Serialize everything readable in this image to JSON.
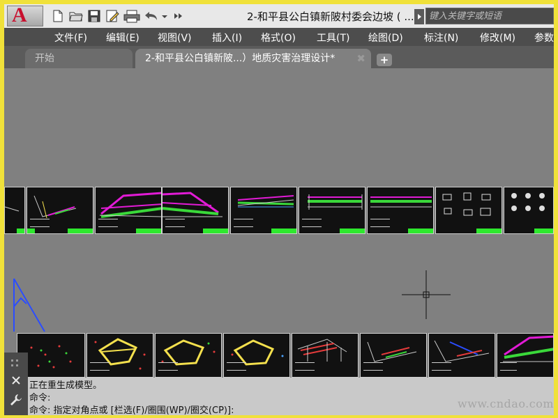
{
  "app": {
    "logo_letter": "A",
    "title": "2-和平县公白镇新陂村委会边坡 ( ..."
  },
  "search": {
    "placeholder": "键入关键字或短语"
  },
  "menu": [
    "文件(F)",
    "编辑(E)",
    "视图(V)",
    "插入(I)",
    "格式(O)",
    "工具(T)",
    "绘图(D)",
    "标注(N)",
    "修改(M)",
    "参数"
  ],
  "tabs": [
    {
      "label": "开始",
      "active": false
    },
    {
      "label": "2-和平县公白镇新陂...）地质灾害治理设计*",
      "active": true,
      "close_glyph": "✖"
    }
  ],
  "tab_add_glyph": "+",
  "command": {
    "lines": [
      "正在重生成模型。",
      "命令:",
      "命令: 指定对角点或 [栏选(F)/圈围(WP)/圈交(CP)]:"
    ]
  },
  "watermark": "www.cndao.com",
  "colors": {
    "accent_yellow": "#f0e13a",
    "sheet_stamp_green": "#2ee82e",
    "magenta": "#e21bd6",
    "logo_red": "#c8102e"
  },
  "icons": [
    "new-file-icon",
    "open-folder-icon",
    "save-icon",
    "save-as-icon",
    "print-icon",
    "undo-icon",
    "dropdown-icon",
    "more-icon",
    "wrench-icon",
    "close-icon",
    "crosshair-icon"
  ]
}
